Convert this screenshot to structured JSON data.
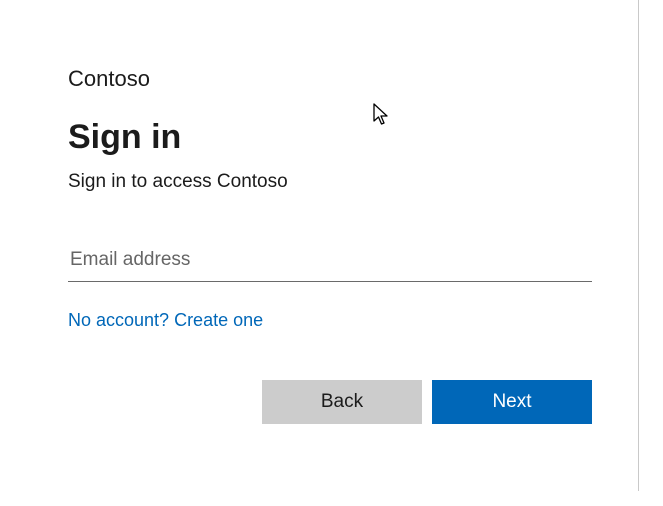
{
  "brand": "Contoso",
  "title": "Sign in",
  "subtitle": "Sign in to access Contoso",
  "email": {
    "placeholder": "Email address",
    "value": ""
  },
  "links": {
    "create": "No account? Create one"
  },
  "buttons": {
    "back": "Back",
    "next": "Next"
  },
  "colors": {
    "accent": "#0067b8",
    "secondaryButton": "#cccccc"
  }
}
